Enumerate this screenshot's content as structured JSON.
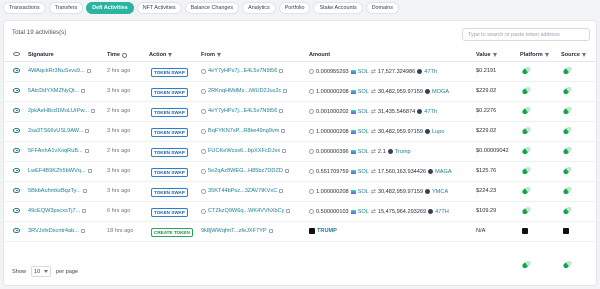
{
  "tabs": [
    "Transactions",
    "Transfers",
    "Defi Activities",
    "NFT Activities",
    "Balance Changes",
    "Analytics",
    "Portfolio",
    "Stake Accounts",
    "Domains"
  ],
  "active_tab": "Defi Activities",
  "summary": "Total 19 activities(s)",
  "search": {
    "placeholder": "Type to search or paste token address"
  },
  "columns": {
    "signature": "Signature",
    "time": "Time",
    "action": "Action",
    "from": "From",
    "amount": "Amount",
    "value": "Value",
    "platform": "Platform",
    "source": "Source"
  },
  "rows": [
    {
      "signature": "4WAqckRr3NuSvvs9...",
      "time": "2 hrs ago",
      "action": "TOKEN SWAP",
      "from": "4eY7yHPs7j...E4L5x7N9t56",
      "amt_in": "0.000955293",
      "tok_in": "SOL",
      "amt_out": "17,527.324986",
      "tok_out": "47Th",
      "value": "$0.2191"
    },
    {
      "signature": "5AtcDdYXMZNyQt...",
      "time": "3 hrs ago",
      "action": "TOKEN SWAP",
      "from": "2RKnqHMdMz...iWUD2Jux2c",
      "amt_in": "1.000000208",
      "tok_in": "SOL",
      "amt_out": "30,482,959.97159",
      "tok_out": "MOGA",
      "value": "$229.02"
    },
    {
      "signature": "2pkAeH8cd1MoLUrPw...",
      "time": "2 hrs ago",
      "action": "TOKEN SWAP",
      "from": "4eY7yHPs7j...E4L5x7N9t56",
      "amt_in": "0.001000202",
      "tok_in": "SOL",
      "amt_out": "31,435.546874",
      "tok_out": "47Th",
      "value": "$0.2276"
    },
    {
      "signature": "2sa3TS66vUSL9AW...",
      "time": "3 hrs ago",
      "action": "TOKEN SWAP",
      "from": "BqFYKN7xP...R8ke49ng9vm",
      "amt_in": "1.000000208",
      "tok_in": "SOL",
      "amt_out": "30,482,959.97159",
      "tok_out": "Lupo",
      "value": "$229.02"
    },
    {
      "signature": "5FFAnhA1vXoqRuB...",
      "time": "2 hrs ago",
      "action": "TOKEN SWAP",
      "from": "FUCKeWcsx6...bpXXFcDJxx",
      "amt_in": "0.000000396",
      "tok_in": "SOL",
      "amt_out": "2.1",
      "tok_out": "Trump",
      "value": "$0.00009042"
    },
    {
      "signature": "LwEF4B9KZh5bWVq...",
      "time": "3 hrs ago",
      "action": "TOKEN SWAP",
      "from": "5e2qAz8WEG...H85bz7DDZD",
      "amt_in": "0.551709759",
      "tok_in": "SOL",
      "amt_out": "17,560,163.934426",
      "tok_out": "MAGA",
      "value": "$125.76"
    },
    {
      "signature": "5BkbAuhmkzBqzTy...",
      "time": "3 hrs ago",
      "action": "TOKEN SWAP",
      "from": "35KT44bPsz...3ZAV7tKVxC",
      "amt_in": "1.000000208",
      "tok_in": "SOL",
      "amt_out": "30,482,959.97159",
      "tok_out": "YMCA",
      "value": "$224.23"
    },
    {
      "signature": "49cEQW3pscxsTj7...",
      "time": "6 hrs ago",
      "action": "TOKEN SWAP",
      "from": "CTZkzQ9W6q...WK4VVhXbCy",
      "amt_in": "0.500000103",
      "tok_in": "SOL",
      "amt_out": "15,475,964.293269",
      "tok_out": "47TH",
      "value": "$109.29"
    },
    {
      "signature": "3RVJxfxDxcntr4ab...",
      "time": "18 hrs ago",
      "action": "CREATE TOKEN",
      "from": "9k8jWWqfmT...zfeJXF7YP",
      "amt_in": "",
      "tok_in": "",
      "amt_out": "",
      "tok_out": "TRUMP",
      "value": "N/A"
    }
  ],
  "footer": {
    "show_label": "Show",
    "page_size": "10",
    "per_page_label": "per page"
  }
}
